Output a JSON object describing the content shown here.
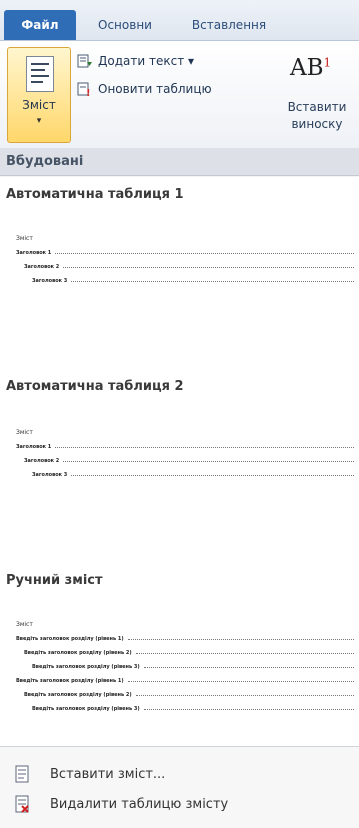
{
  "tabs": [
    {
      "label": "Файл"
    },
    {
      "label": "Основни"
    },
    {
      "label": "Вставлення"
    }
  ],
  "ribbon": {
    "toc_button_label": "Зміст",
    "add_text_label": "Додати текст ▾",
    "update_table_label": "Оновити таблицю",
    "insert_footnote_big": "AB",
    "insert_footnote_sup": "1",
    "insert_footnote_line1": "Вставити",
    "insert_footnote_line2": "виноску"
  },
  "gallery": {
    "group_header": "Вбудовані",
    "items": [
      {
        "title": "Автоматична таблиця 1",
        "preview_heading": "Зміст",
        "lines": [
          "Заголовок 1",
          "Заголовок 2",
          "Заголовок 3"
        ]
      },
      {
        "title": "Автоматична таблиця 2",
        "preview_heading": "Зміст",
        "lines": [
          "Заголовок 1",
          "Заголовок 2",
          "Заголовок 3"
        ]
      },
      {
        "title": "Ручний зміст",
        "preview_heading": "Зміст",
        "lines": [
          "Введіть заголовок розділу (рівень 1)",
          "Введіть заголовок розділу (рівень 2)",
          "Введіть заголовок розділу (рівень 3)",
          "Введіть заголовок розділу (рівень 1)",
          "Введіть заголовок розділу (рівень 2)",
          "Введіть заголовок розділу (рівень 3)"
        ]
      }
    ]
  },
  "menu": {
    "insert_toc": "Вставити зміст...",
    "remove_toc": "Видалити таблицю змісту"
  }
}
